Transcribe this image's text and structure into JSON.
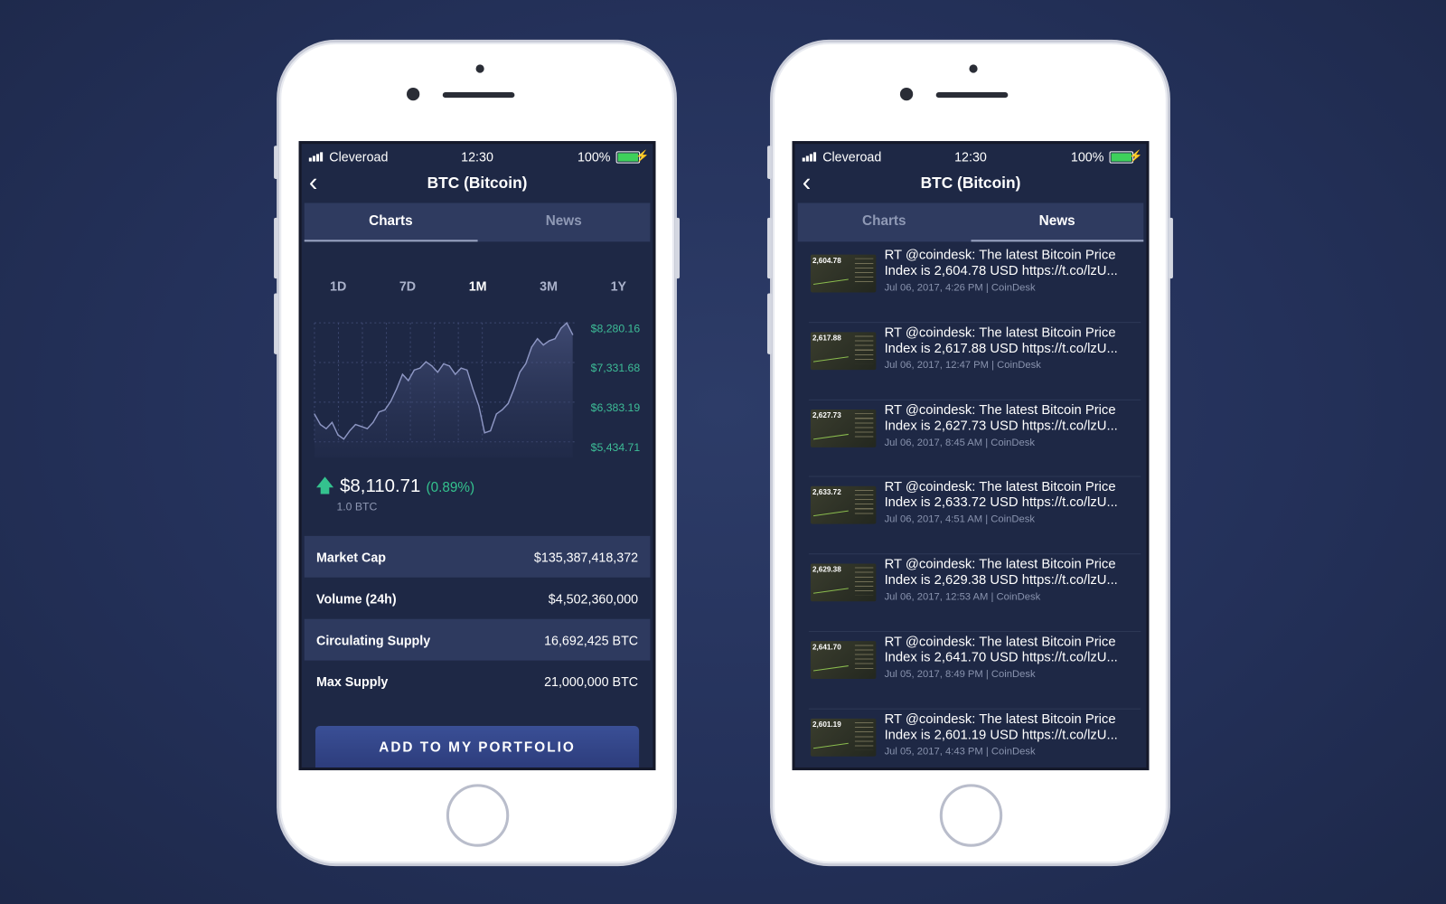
{
  "status_bar": {
    "carrier": "Cleveroad",
    "time": "12:30",
    "battery": "100%",
    "battery_level": 1.0
  },
  "header": {
    "title": "BTC (Bitcoin)",
    "back_icon": "chevron-left-icon"
  },
  "tabs": [
    {
      "label": "Charts"
    },
    {
      "label": "News"
    }
  ],
  "charts_screen": {
    "active_tab": "Charts",
    "periods": [
      "1D",
      "7D",
      "1M",
      "3M",
      "1Y"
    ],
    "active_period": "1M",
    "y_labels": [
      "$8,280.16",
      "$7,331.68",
      "$6,383.19",
      "$5,434.71"
    ],
    "price": "$8,110.71",
    "change": "(0.89%)",
    "amount": "1.0 BTC",
    "colors": {
      "accent_green": "#34c28e",
      "line": "#8e97c4"
    },
    "stats": [
      {
        "label": "Market Cap",
        "value": "$135,387,418,372"
      },
      {
        "label": "Volume (24h)",
        "value": "$4,502,360,000"
      },
      {
        "label": "Circulating Supply",
        "value": "16,692,425 BTC"
      },
      {
        "label": "Max Supply",
        "value": "21,000,000 BTC"
      }
    ],
    "button": "ADD TO MY PORTFOLIO"
  },
  "chart_data": {
    "type": "area",
    "ylim": [
      5434.71,
      8280.16
    ],
    "y_ticks": [
      "$8,280.16",
      "$7,331.68",
      "$6,383.19",
      "$5,434.71"
    ],
    "grid": true,
    "values": [
      6100,
      5850,
      5750,
      5900,
      5600,
      5500,
      5700,
      5850,
      5800,
      5750,
      5900,
      6150,
      6200,
      6400,
      6700,
      7050,
      6900,
      7150,
      7200,
      7350,
      7250,
      7100,
      7300,
      7250,
      7050,
      7200,
      7150,
      6700,
      6300,
      5650,
      5700,
      6100,
      6200,
      6350,
      6700,
      7100,
      7300,
      7700,
      7900,
      7750,
      7850,
      7900,
      8150,
      8280,
      8000
    ]
  },
  "news_screen": {
    "active_tab": "News",
    "items": [
      {
        "thumb": "2,604.78",
        "title_1": "RT @coindesk: The latest Bitcoin Price",
        "title_2": "Index is 2,604.78 USD https://t.co/lzU...",
        "meta": "Jul 06, 2017, 4:26 PM | CoinDesk"
      },
      {
        "thumb": "2,617.88",
        "title_1": "RT @coindesk: The latest Bitcoin Price",
        "title_2": "Index is 2,617.88 USD https://t.co/lzU...",
        "meta": "Jul 06, 2017, 12:47 PM | CoinDesk"
      },
      {
        "thumb": "2,627.73",
        "title_1": "RT @coindesk: The latest Bitcoin Price",
        "title_2": "Index is 2,627.73 USD https://t.co/lzU...",
        "meta": "Jul 06, 2017, 8:45 AM | CoinDesk"
      },
      {
        "thumb": "2,633.72",
        "title_1": "RT @coindesk: The latest Bitcoin Price",
        "title_2": "Index is 2,633.72 USD https://t.co/lzU...",
        "meta": "Jul 06, 2017, 4:51 AM | CoinDesk"
      },
      {
        "thumb": "2,629.38",
        "title_1": "RT @coindesk: The latest Bitcoin Price",
        "title_2": "Index is 2,629.38 USD https://t.co/lzU...",
        "meta": "Jul 06, 2017, 12:53 AM | CoinDesk"
      },
      {
        "thumb": "2,641.70",
        "title_1": "RT @coindesk: The latest Bitcoin Price",
        "title_2": "Index is 2,641.70 USD https://t.co/lzU...",
        "meta": "Jul 05, 2017, 8:49 PM | CoinDesk"
      },
      {
        "thumb": "2,601.19",
        "title_1": "RT @coindesk: The latest Bitcoin Price",
        "title_2": "Index is 2,601.19 USD https://t.co/lzU...",
        "meta": "Jul 05, 2017, 4:43 PM | CoinDesk"
      }
    ]
  }
}
